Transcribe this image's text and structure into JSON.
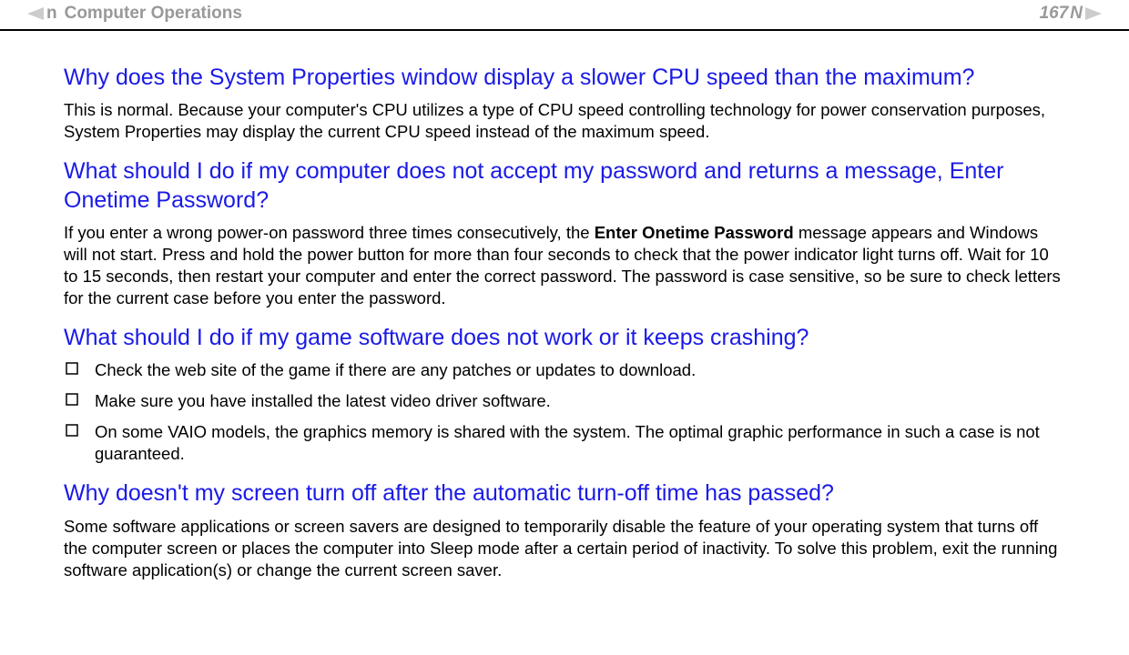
{
  "header": {
    "section_title": "Computer Operations",
    "page_number": "167",
    "nav_hint_n": "n",
    "nav_hint_N": "N"
  },
  "sections": [
    {
      "heading": "Why does the System Properties window display a slower CPU speed than the maximum?",
      "body": "This is normal. Because your computer's CPU utilizes a type of CPU speed controlling technology for power conservation purposes, System Properties may display the current CPU speed instead of the maximum speed."
    },
    {
      "heading": "What should I do if my computer does not accept my password and returns a message, Enter Onetime Password?",
      "body_prefix": "If you enter a wrong power-on password three times consecutively, the ",
      "body_bold": "Enter Onetime Password",
      "body_suffix": " message appears and Windows will not start. Press and hold the power button for more than four seconds to check that the power indicator light turns off. Wait for 10 to 15 seconds, then restart your computer and enter the correct password. The password is case sensitive, so be sure to check letters for the current case before you enter the password."
    },
    {
      "heading": "What should I do if my game software does not work or it keeps crashing?",
      "list": [
        "Check the web site of the game if there are any patches or updates to download.",
        "Make sure you have installed the latest video driver software.",
        "On some VAIO models, the graphics memory is shared with the system. The optimal graphic performance in such a case is not guaranteed."
      ]
    },
    {
      "heading": "Why doesn't my screen turn off after the automatic turn-off time has passed?",
      "body": "Some software applications or screen savers are designed to temporarily disable the feature of your operating system that turns off the computer screen or places the computer into Sleep mode after a certain period of inactivity. To solve this problem, exit the running software application(s) or change the current screen saver."
    }
  ]
}
